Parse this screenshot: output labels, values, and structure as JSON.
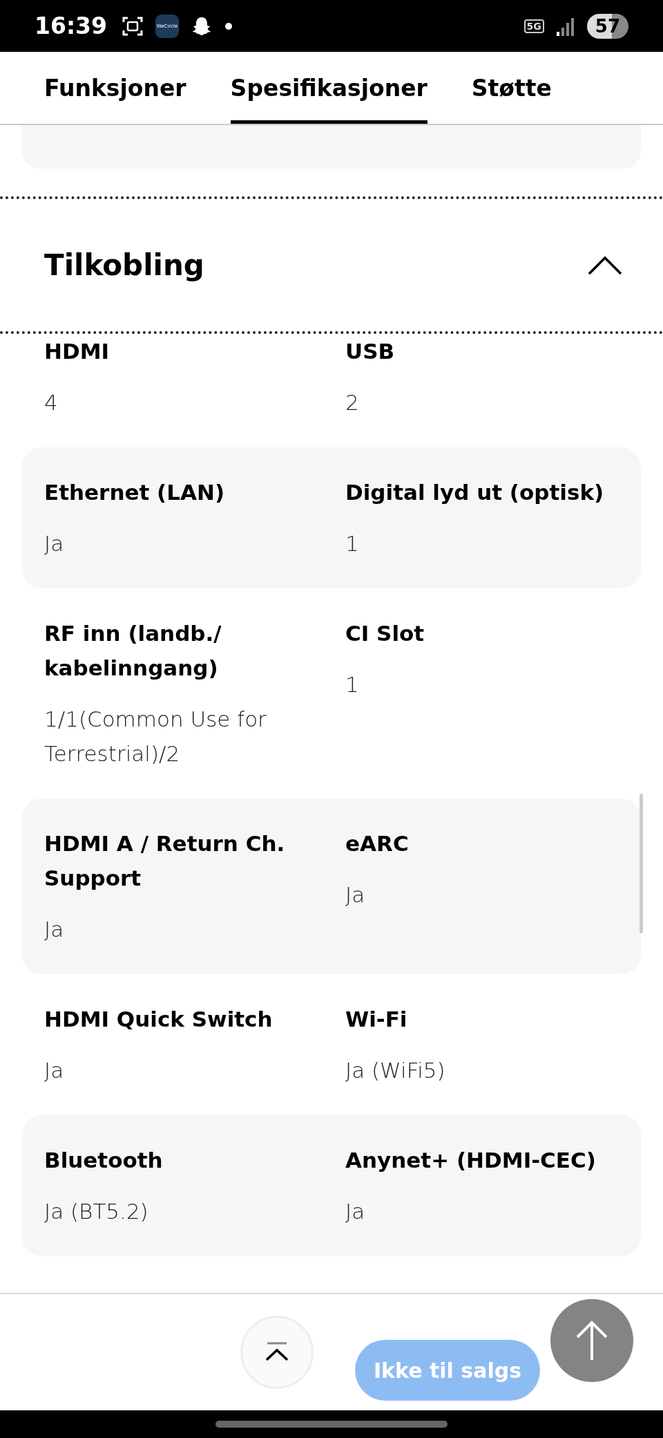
{
  "status_bar": {
    "time": "16:39",
    "app_badge": "WeCircle",
    "network": "5G",
    "battery": "57"
  },
  "tabs": [
    {
      "label": "Funksjoner",
      "selected": false
    },
    {
      "label": "Spesifikasjoner",
      "selected": true
    },
    {
      "label": "Støtte",
      "selected": false
    }
  ],
  "section": {
    "title": "Tilkobling",
    "expanded": true
  },
  "specs": [
    {
      "items": [
        {
          "label": "HDMI",
          "value": "4"
        },
        {
          "label": "USB",
          "value": "2"
        }
      ]
    },
    {
      "items": [
        {
          "label": "Ethernet (LAN)",
          "value": "Ja"
        },
        {
          "label": "Digital lyd ut (optisk)",
          "value": "1"
        }
      ]
    },
    {
      "items": [
        {
          "label": "RF inn (landb./ kabelinngang)",
          "value": "1/1(Common Use for Terrestrial)/2"
        },
        {
          "label": "CI Slot",
          "value": "1"
        }
      ]
    },
    {
      "items": [
        {
          "label": "HDMI A / Return Ch. Support",
          "value": "Ja"
        },
        {
          "label": "eARC",
          "value": "Ja"
        }
      ]
    },
    {
      "items": [
        {
          "label": "HDMI Quick Switch",
          "value": "Ja"
        },
        {
          "label": "Wi-Fi",
          "value": "Ja (WiFi5)"
        }
      ]
    },
    {
      "items": [
        {
          "label": "Bluetooth",
          "value": "Ja (BT5.2)"
        },
        {
          "label": "Anynet+ (HDMI-CEC)",
          "value": "Ja"
        }
      ]
    }
  ],
  "footer": {
    "sale_button": "Ikke til salgs",
    "sale_disabled": true
  }
}
